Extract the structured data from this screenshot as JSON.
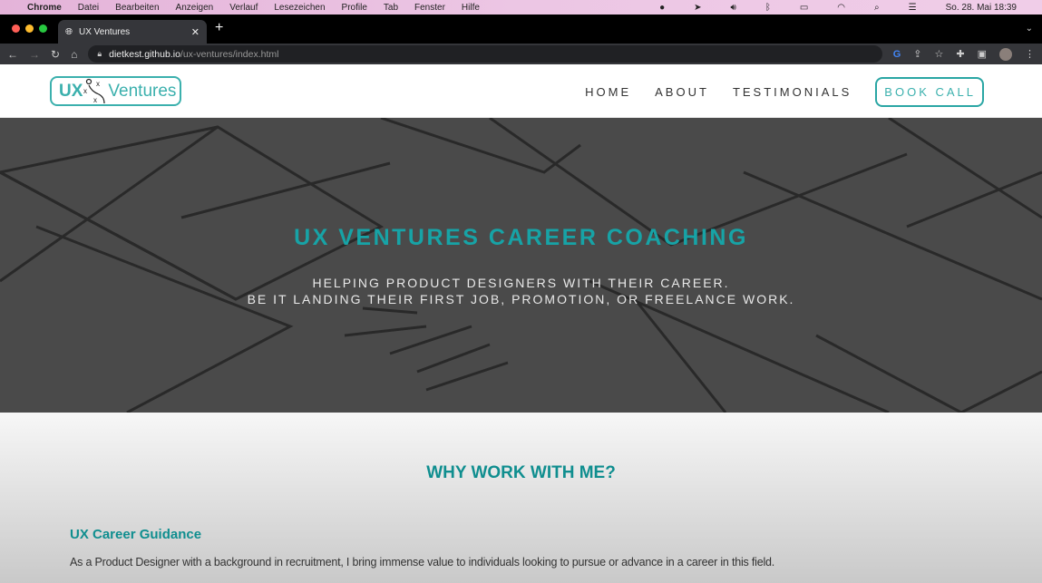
{
  "menubar": {
    "app": "Chrome",
    "items": [
      "Datei",
      "Bearbeiten",
      "Anzeigen",
      "Verlauf",
      "Lesezeichen",
      "Profile",
      "Tab",
      "Fenster",
      "Hilfe"
    ],
    "clock": "So. 28. Mai  18:39"
  },
  "browser": {
    "tab_title": "UX Ventures",
    "url_host": "dietkest.github.io",
    "url_path": "/ux-ventures/index.html"
  },
  "header": {
    "logo_ux": "UX",
    "logo_ventures": "Ventures",
    "nav": [
      "HOME",
      "ABOUT",
      "TESTIMONIALS"
    ],
    "cta": "BOOK CALL"
  },
  "hero": {
    "title": "UX VENTURES CAREER COACHING",
    "line1": "HELPING PRODUCT DESIGNERS WITH THEIR CAREER.",
    "line2": "BE IT LANDING THEIR FIRST JOB, PROMOTION, OR FREELANCE WORK."
  },
  "why": {
    "title": "WHY WORK WITH ME?",
    "subtitle": "UX Career Guidance",
    "text": "As a Product Designer with a background in recruitment, I bring immense value to individuals looking to pursue or advance in a career in this field."
  },
  "colors": {
    "accent": "#17a3a6",
    "hero_bg": "#4a4a4a"
  }
}
